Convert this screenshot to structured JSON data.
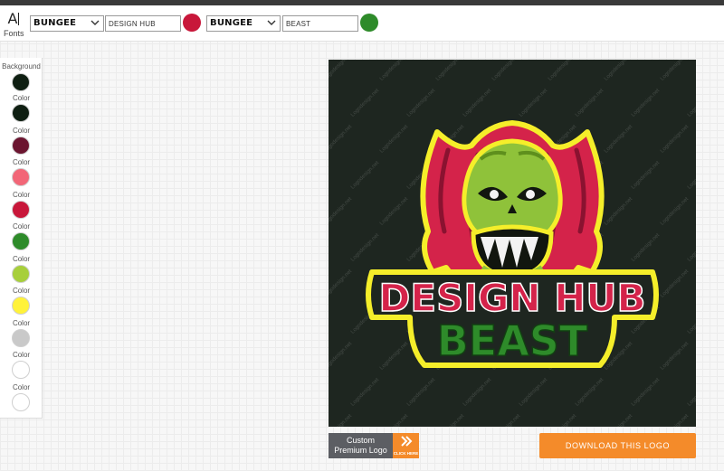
{
  "toolbar": {
    "fonts_label": "Fonts",
    "text1": {
      "font": "BUNGEE",
      "value": "DESIGN HUB",
      "color": "#c8173a"
    },
    "text2": {
      "font": "BUNGEE",
      "value": "BEAST",
      "color": "#2e8b2a"
    }
  },
  "sidebar": {
    "background_label": "Background",
    "background_color": "#0f1f12",
    "color_label": "Color",
    "swatches": [
      "#0f1f12",
      "#6b1530",
      "#f26677",
      "#c8173a",
      "#2e8b2a",
      "#a7cf3b",
      "#fff23a",
      "#c9c9c9",
      "#ffffff",
      "#ffffff"
    ]
  },
  "logo": {
    "line1": "DESIGN HUB",
    "line2": "BEAST",
    "watermark": "Logodesign.net"
  },
  "buttons": {
    "custom_line1": "Custom",
    "custom_line2": "Premium Logo",
    "click_here": "CLICK HERE",
    "download": "DOWNLOAD THIS LOGO"
  }
}
